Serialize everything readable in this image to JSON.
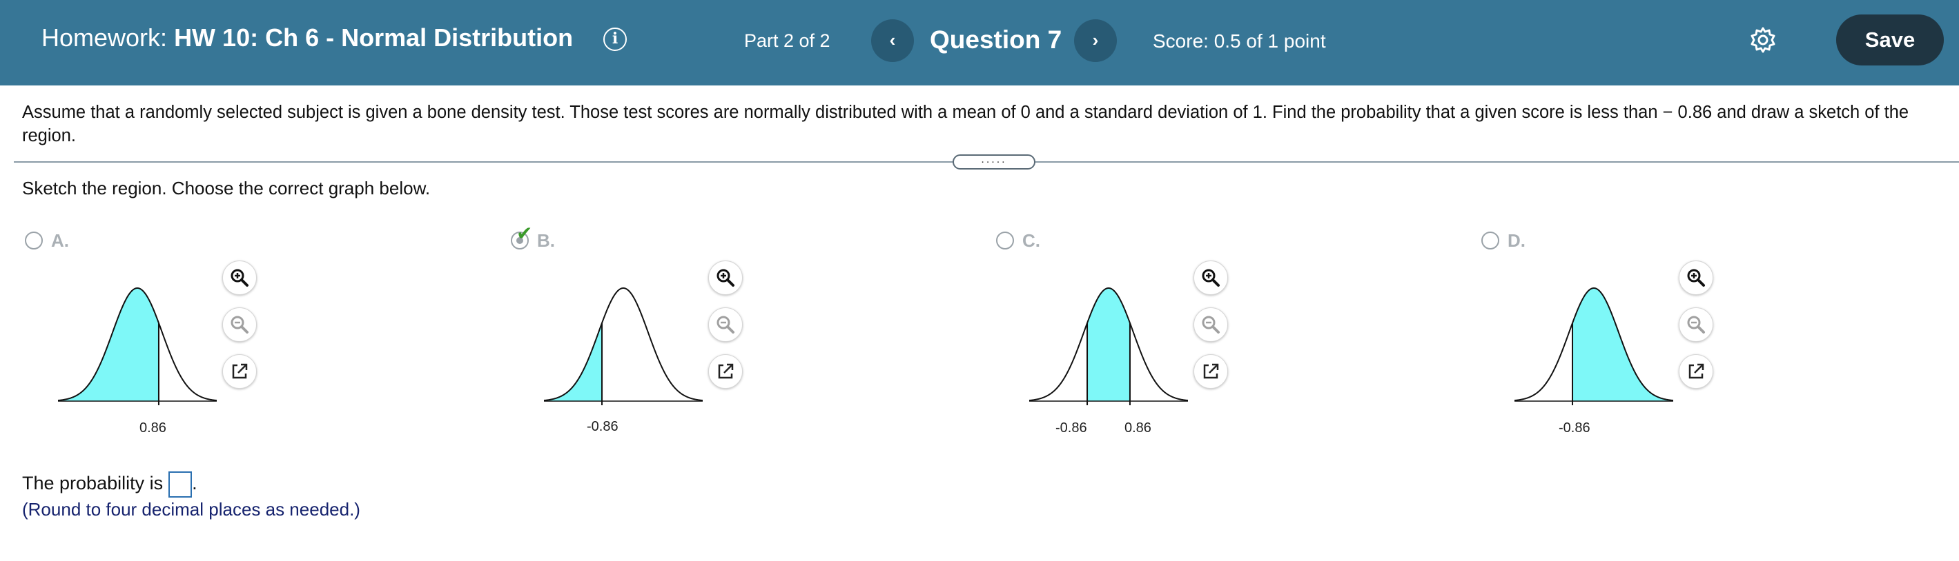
{
  "header": {
    "title_prefix": "Homework:",
    "title_name": "HW 10: Ch 6 - Normal Distribution",
    "info_glyph": "i",
    "part": "Part 2 of 2",
    "prev_glyph": "‹",
    "question": "Question 7",
    "next_glyph": "›",
    "score": "Score: 0.5 of 1 point",
    "save_label": "Save",
    "bg_color": "#377696"
  },
  "question": {
    "text": "Assume that a randomly selected subject is given a bone density test. Those test scores are normally distributed with a mean of 0 and a standard deviation of 1. Find the probability that a given score is less than  − 0.86 and draw a sketch of the region.",
    "handle_dots": ".....",
    "sketch_prompt": "Sketch the region. Choose the correct graph below."
  },
  "options": [
    {
      "letter": "A.",
      "selected": false,
      "checked": false,
      "labels": [
        "0.86"
      ],
      "region": "left-of-0.86"
    },
    {
      "letter": "B.",
      "selected": true,
      "checked": true,
      "check_glyph": "✔",
      "labels": [
        "-0.86"
      ],
      "region": "left-of--0.86"
    },
    {
      "letter": "C.",
      "selected": false,
      "checked": false,
      "labels": [
        "-0.86",
        "0.86"
      ],
      "region": "between--0.86-and-0.86"
    },
    {
      "letter": "D.",
      "selected": false,
      "checked": false,
      "labels": [
        "-0.86"
      ],
      "region": "right-of--0.86"
    }
  ],
  "answer": {
    "prompt": "The probability is",
    "value": "",
    "period": ".",
    "hint": "(Round to four decimal places as needed.)"
  },
  "colors": {
    "shade": "#7ef8f8",
    "accent_button": "#1f3542",
    "input_border": "#2a6fb0",
    "hint_text": "#16236e"
  },
  "icons": [
    "info-icon",
    "chevron-left-icon",
    "chevron-right-icon",
    "gear-icon",
    "zoom-in-icon",
    "zoom-out-icon",
    "open-external-icon",
    "checkmark-icon"
  ]
}
